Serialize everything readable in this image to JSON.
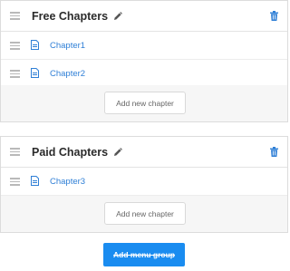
{
  "groups": [
    {
      "title": "Free Chapters",
      "chapters": [
        {
          "label": "Chapter1"
        },
        {
          "label": "Chapter2"
        }
      ],
      "add_chapter_label": "Add new chapter"
    },
    {
      "title": "Paid Chapters",
      "chapters": [
        {
          "label": "Chapter3"
        }
      ],
      "add_chapter_label": "Add new chapter"
    }
  ],
  "add_group_label": "Add menu group",
  "colors": {
    "link": "#2f7fd6",
    "trash": "#2f7fd6",
    "primary_button": "#1a8cf0",
    "footer_bg": "#f6f6f6"
  },
  "icons": {
    "group_drag": "drag-handle-icon",
    "edit": "pencil-icon",
    "delete": "trash-icon",
    "chapter_doc": "document-icon"
  }
}
